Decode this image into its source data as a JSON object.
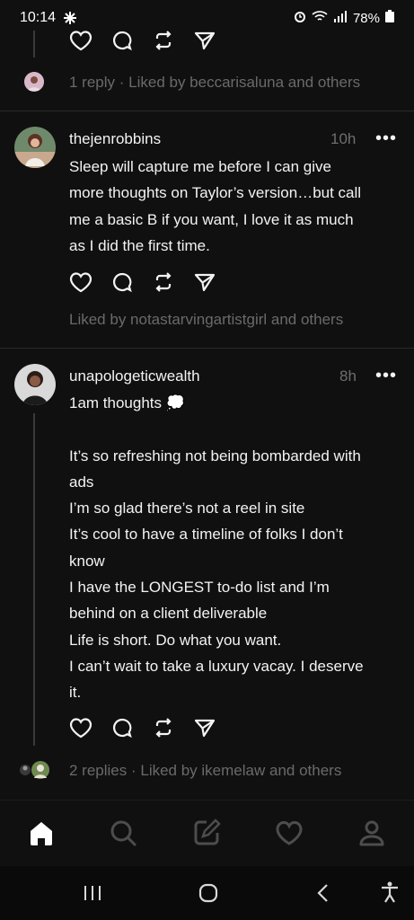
{
  "status_bar": {
    "time": "10:14",
    "battery": "78%"
  },
  "posts": [
    {
      "meta_text": "1 reply · Liked by beccarisaluna and others"
    },
    {
      "username": "thejenrobbins",
      "time": "10h",
      "more": "•••",
      "text_lines": [
        "Sleep will capture me before I can give",
        "more thoughts on Taylor’s version…but call",
        "me a basic B if you want, I love it as much",
        "as I did the first time."
      ],
      "meta_text": "Liked by notastarvingartistgirl and others"
    },
    {
      "username": "unapologeticwealth",
      "time": "8h",
      "more": "•••",
      "text_lines": [
        "1am thoughts 💭",
        "",
        "It’s so refreshing not being bombarded with",
        "ads",
        "I’m so glad there’s not a reel in site",
        "It’s cool to have a timeline of folks I don’t",
        "know",
        "I have the LONGEST to-do list and I’m",
        "behind on a client deliverable",
        "Life is short. Do what you want.",
        "I can’t wait to take a luxury vacay. I deserve",
        "it."
      ],
      "meta_text": "2 replies · Liked by ikemelaw and others"
    }
  ],
  "colors": {
    "background": "#101010",
    "text": "#f3f3f3",
    "muted": "#6a6a6a",
    "active_nav": "#ffffff",
    "inactive_nav": "#4d4d4d"
  },
  "bottom_nav": [
    "home-icon",
    "search-icon",
    "compose-icon",
    "heart-icon",
    "profile-icon"
  ],
  "system_nav": [
    "recents-icon",
    "home-button-icon",
    "back-icon",
    "accessibility-icon"
  ]
}
